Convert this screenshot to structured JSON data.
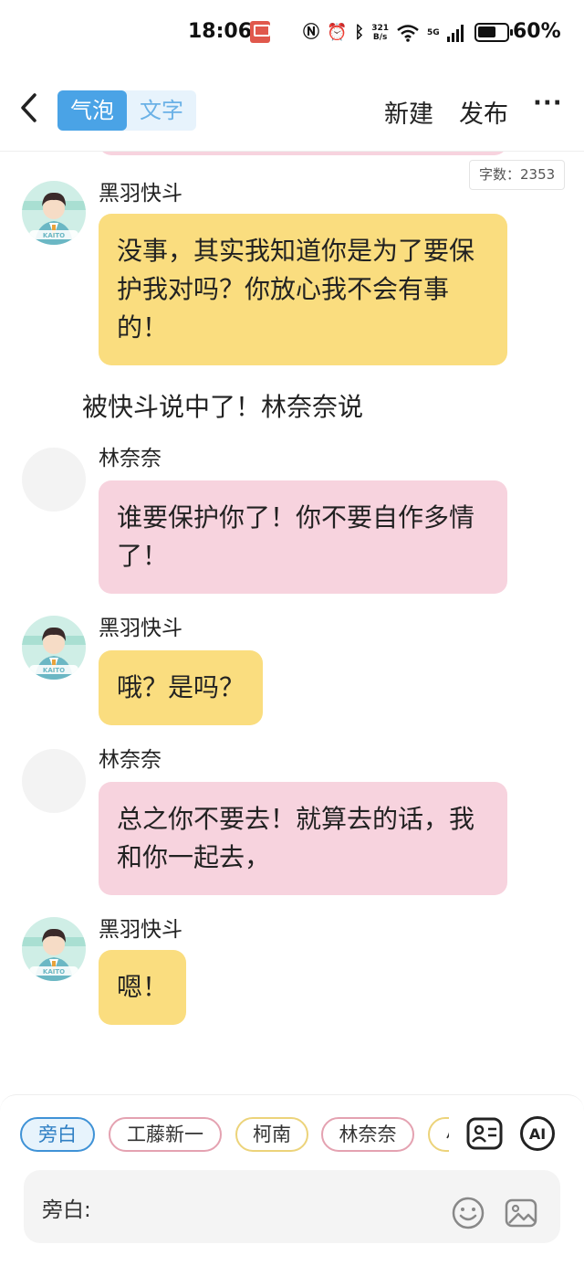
{
  "status_bar": {
    "time": "18:06",
    "net_speed_value": "321",
    "net_speed_unit": "B/s",
    "network": "5G",
    "battery": "60%"
  },
  "header": {
    "tabs": [
      {
        "label": "气泡",
        "active": true
      },
      {
        "label": "文字",
        "active": false
      }
    ],
    "new_label": "新建",
    "publish_label": "发布",
    "more_label": "···"
  },
  "word_count": "字数：2353",
  "messages": [
    {
      "speaker": "黑羽快斗",
      "text": "没事，其实我知道你是为了要保护我对吗？你放心我不会有事的！",
      "bubble_color": "#fadd7f"
    },
    {
      "narration": "被快斗说中了！林奈奈说"
    },
    {
      "speaker": "林奈奈",
      "text": "谁要保护你了！你不要自作多情了！",
      "bubble_color": "#f7d3de"
    },
    {
      "speaker": "黑羽快斗",
      "text": "哦？是吗？",
      "bubble_color": "#fadd7f"
    },
    {
      "speaker": "林奈奈",
      "text": "总之你不要去！就算去的话，我和你一起去，",
      "bubble_color": "#f7d3de"
    },
    {
      "speaker": "黑羽快斗",
      "text": "嗯！",
      "bubble_color": "#fadd7f"
    }
  ],
  "avatar_text": "KAITO",
  "role_chips": [
    "旁白",
    "工藤新一",
    "柯南",
    "林奈奈",
    "小"
  ],
  "input": {
    "role_label": "旁白:"
  },
  "ai_label": "AI",
  "colors": {
    "accent_blue": "#4aa3e6",
    "bubble_yellow": "#fadd7f",
    "bubble_pink": "#f7d3de"
  }
}
